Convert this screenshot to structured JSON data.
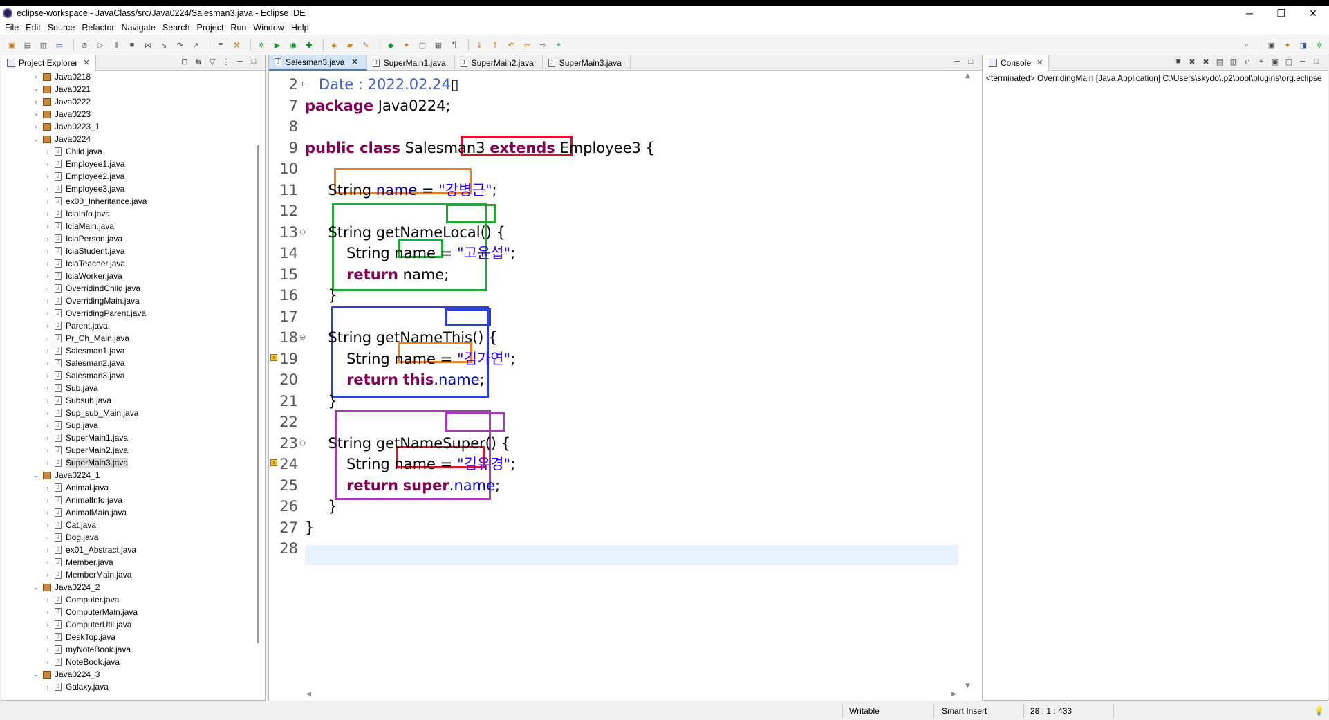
{
  "window": {
    "title": "eclipse-workspace - JavaClass/src/Java0224/Salesman3.java - Eclipse IDE",
    "minimize": "─",
    "restore": "❐",
    "close": "✕"
  },
  "menu": [
    "File",
    "Edit",
    "Source",
    "Refactor",
    "Navigate",
    "Search",
    "Project",
    "Run",
    "Window",
    "Help"
  ],
  "explorer": {
    "tab_label": "Project Explorer",
    "items": [
      {
        "label": "Java0218",
        "type": "package",
        "level": 0,
        "expanded": false
      },
      {
        "label": "Java0221",
        "type": "package",
        "level": 0,
        "expanded": false
      },
      {
        "label": "Java0222",
        "type": "package",
        "level": 0,
        "expanded": false
      },
      {
        "label": "Java0223",
        "type": "package",
        "level": 0,
        "expanded": false
      },
      {
        "label": "Java0223_1",
        "type": "package",
        "level": 0,
        "expanded": false
      },
      {
        "label": "Java0224",
        "type": "package",
        "level": 0,
        "expanded": true
      },
      {
        "label": "Child.java",
        "type": "file",
        "level": 1
      },
      {
        "label": "Employee1.java",
        "type": "file",
        "level": 1
      },
      {
        "label": "Employee2.java",
        "type": "file",
        "level": 1
      },
      {
        "label": "Employee3.java",
        "type": "file",
        "level": 1
      },
      {
        "label": "ex00_Inheritance.java",
        "type": "file",
        "level": 1
      },
      {
        "label": "IciaInfo.java",
        "type": "file",
        "level": 1
      },
      {
        "label": "IciaMain.java",
        "type": "file",
        "level": 1
      },
      {
        "label": "IciaPerson.java",
        "type": "file",
        "level": 1
      },
      {
        "label": "IciaStudent.java",
        "type": "file",
        "level": 1
      },
      {
        "label": "IciaTeacher.java",
        "type": "file",
        "level": 1
      },
      {
        "label": "IciaWorker.java",
        "type": "file",
        "level": 1
      },
      {
        "label": "OverridindChild.java",
        "type": "file",
        "level": 1
      },
      {
        "label": "OverridingMain.java",
        "type": "file",
        "level": 1
      },
      {
        "label": "OverridingParent.java",
        "type": "file",
        "level": 1
      },
      {
        "label": "Parent.java",
        "type": "file",
        "level": 1
      },
      {
        "label": "Pr_Ch_Main.java",
        "type": "file",
        "level": 1
      },
      {
        "label": "Salesman1.java",
        "type": "file",
        "level": 1
      },
      {
        "label": "Salesman2.java",
        "type": "file",
        "level": 1
      },
      {
        "label": "Salesman3.java",
        "type": "file",
        "level": 1
      },
      {
        "label": "Sub.java",
        "type": "file",
        "level": 1
      },
      {
        "label": "Subsub.java",
        "type": "file",
        "level": 1
      },
      {
        "label": "Sup_sub_Main.java",
        "type": "file",
        "level": 1
      },
      {
        "label": "Sup.java",
        "type": "file",
        "level": 1
      },
      {
        "label": "SuperMain1.java",
        "type": "file",
        "level": 1
      },
      {
        "label": "SuperMain2.java",
        "type": "file",
        "level": 1
      },
      {
        "label": "SuperMain3.java",
        "type": "file",
        "level": 1,
        "selected": true
      },
      {
        "label": "Java0224_1",
        "type": "package",
        "level": 0,
        "expanded": true
      },
      {
        "label": "Animal.java",
        "type": "file",
        "level": 1
      },
      {
        "label": "AnimalInfo.java",
        "type": "file",
        "level": 1
      },
      {
        "label": "AnimalMain.java",
        "type": "file",
        "level": 1
      },
      {
        "label": "Cat.java",
        "type": "file",
        "level": 1
      },
      {
        "label": "Dog.java",
        "type": "file",
        "level": 1
      },
      {
        "label": "ex01_Abstract.java",
        "type": "file",
        "level": 1
      },
      {
        "label": "Member.java",
        "type": "file",
        "level": 1
      },
      {
        "label": "MemberMain.java",
        "type": "file",
        "level": 1
      },
      {
        "label": "Java0224_2",
        "type": "package",
        "level": 0,
        "expanded": true
      },
      {
        "label": "Computer.java",
        "type": "file",
        "level": 1
      },
      {
        "label": "ComputerMain.java",
        "type": "file",
        "level": 1
      },
      {
        "label": "ComputerUtil.java",
        "type": "file",
        "level": 1
      },
      {
        "label": "DeskTop.java",
        "type": "file",
        "level": 1
      },
      {
        "label": "myNoteBook.java",
        "type": "file",
        "level": 1
      },
      {
        "label": "NoteBook.java",
        "type": "file",
        "level": 1
      },
      {
        "label": "Java0224_3",
        "type": "package",
        "level": 0,
        "expanded": true
      },
      {
        "label": "Galaxy.java",
        "type": "file",
        "level": 1
      }
    ]
  },
  "editor": {
    "tabs": [
      {
        "label": "Salesman3.java",
        "active": true
      },
      {
        "label": "SuperMain1.java",
        "active": false
      },
      {
        "label": "SuperMain2.java",
        "active": false
      },
      {
        "label": "SuperMain3.java",
        "active": false
      }
    ],
    "lines": [
      {
        "num": "2",
        "html": "   <span class=\"doc\">Date : 2022.02.24</span>▯",
        "fold": "+"
      },
      {
        "num": "7",
        "html": "<span class=\"kw\">package</span> Java0224;"
      },
      {
        "num": "8",
        "html": ""
      },
      {
        "num": "9",
        "html": "<span class=\"kw\">public class</span> Salesman3 <span class=\"kw\">extends</span> Employee3 {"
      },
      {
        "num": "10",
        "html": ""
      },
      {
        "num": "11",
        "html": "     String <span class=\"fd\">name</span> = <span class=\"st\">\"강병근\"</span>;"
      },
      {
        "num": "12",
        "html": ""
      },
      {
        "num": "13",
        "html": "     String getNameLocal() {",
        "fold": "⊖"
      },
      {
        "num": "14",
        "html": "         String name = <span class=\"st\">\"고윤섭\"</span>;"
      },
      {
        "num": "15",
        "html": "         <span class=\"kw\">return</span> name;"
      },
      {
        "num": "16",
        "html": "     }"
      },
      {
        "num": "17",
        "html": ""
      },
      {
        "num": "18",
        "html": "     String getNameThis() {",
        "fold": "⊖"
      },
      {
        "num": "19",
        "html": "         String name = <span class=\"st\">\"김가연\"</span>;",
        "warn": true
      },
      {
        "num": "20",
        "html": "         <span class=\"kw\">return</span> <span class=\"kw\">this</span>.<span class=\"fd\">name</span>;"
      },
      {
        "num": "21",
        "html": "     }"
      },
      {
        "num": "22",
        "html": ""
      },
      {
        "num": "23",
        "html": "     String getNameSuper() {",
        "fold": "⊖"
      },
      {
        "num": "24",
        "html": "         String name = <span class=\"st\">\"김유경\"</span>;",
        "warn": true
      },
      {
        "num": "25",
        "html": "         <span class=\"kw\">return</span> <span class=\"kw\">super</span>.<span class=\"fd\">name</span>;"
      },
      {
        "num": "26",
        "html": "     }"
      },
      {
        "num": "27",
        "html": "}"
      },
      {
        "num": "28",
        "html": ""
      }
    ]
  },
  "console": {
    "tab_label": "Console",
    "text": "<terminated> OverridingMain [Java Application] C:\\Users\\skydo\\.p2\\pool\\plugins\\org.eclipse"
  },
  "status": {
    "writable": "Writable",
    "insert_mode": "Smart Insert",
    "position": "28 : 1 : 433"
  },
  "colors": {
    "red_box": "#e0102a",
    "orange_box": "#ef7d22",
    "green_box": "#21a838",
    "blue_box": "#2c3fd6",
    "purple_box": "#a43cb4",
    "keyword": "#7f0055",
    "string": "#2a00ff",
    "field": "#0000c0"
  }
}
